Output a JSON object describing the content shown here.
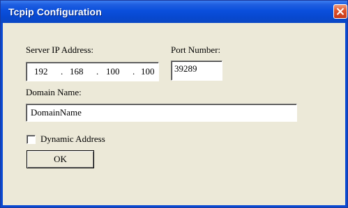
{
  "window": {
    "title": "Tcpip Configuration",
    "close_icon": "close-icon",
    "colors": {
      "titlebar": "#0a4fdc",
      "close_button": "#e0532a",
      "dialog_background": "#ece9d8"
    }
  },
  "form": {
    "server_ip_label": "Server IP Address:",
    "ip_octets": [
      "192",
      "168",
      "100",
      "100"
    ],
    "ip_separator": ".",
    "port_label": "Port Number:",
    "port_value": "39289",
    "domain_label": "Domain Name:",
    "domain_value": "DomainName",
    "dynamic_address_label": "Dynamic Address",
    "dynamic_address_checked": false,
    "ok_label": "OK"
  }
}
